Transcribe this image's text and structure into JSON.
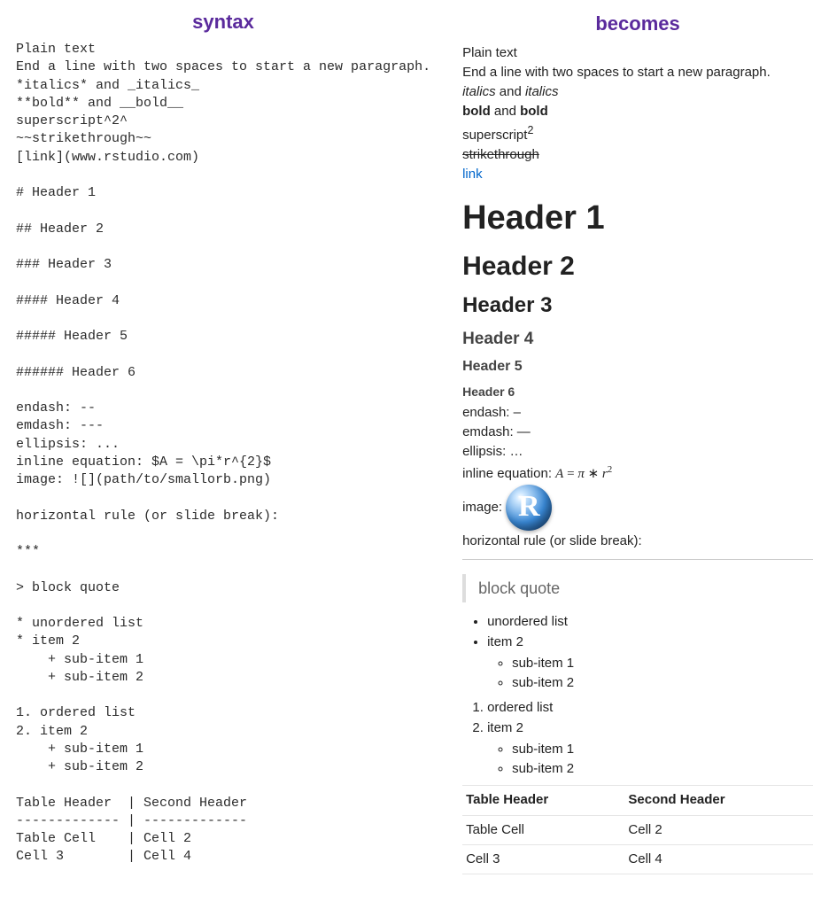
{
  "titles": {
    "left": "syntax",
    "right": "becomes"
  },
  "syntax_block": "Plain text\nEnd a line with two spaces to start a new paragraph.\n*italics* and _italics_\n**bold** and __bold__\nsuperscript^2^\n~~strikethrough~~\n[link](www.rstudio.com)\n\n# Header 1\n\n## Header 2\n\n### Header 3\n\n#### Header 4\n\n##### Header 5\n\n###### Header 6\n\nendash: --\nemdash: ---\nellipsis: ...\ninline equation: $A = \\pi*r^{2}$\nimage: ![](path/to/smallorb.png)\n\nhorizontal rule (or slide break):\n\n***\n\n> block quote\n\n* unordered list\n* item 2\n    + sub-item 1\n    + sub-item 2\n\n1. ordered list\n2. item 2\n    + sub-item 1\n    + sub-item 2\n\nTable Header  | Second Header\n------------- | -------------\nTable Cell    | Cell 2\nCell 3        | Cell 4",
  "rendered": {
    "plain1": "Plain text",
    "plain2": "End a line with two spaces to start a new paragraph.",
    "italics_word": "italics",
    "and": " and ",
    "bold_word": "bold",
    "superscript_label": "superscript",
    "superscript_exp": "2",
    "strikethrough": "strikethrough",
    "link_text": "link",
    "h1": "Header 1",
    "h2": "Header 2",
    "h3": "Header 3",
    "h4": "Header 4",
    "h5": "Header 5",
    "h6": "Header 6",
    "endash_label": "endash: ",
    "endash": "–",
    "emdash_label": "emdash: ",
    "emdash": "—",
    "ellipsis_label": "ellipsis: ",
    "ellipsis": "…",
    "eq_label": "inline equation: ",
    "eq_A": "A",
    "eq_eq": " = ",
    "eq_pi": "π",
    "eq_star": " ∗ ",
    "eq_r": "r",
    "eq_exp": "2",
    "image_label": "image: ",
    "rlogo_letter": "R",
    "hr_label": "horizontal rule (or slide break):",
    "blockquote": "block quote",
    "ul_item1": "unordered list",
    "ul_item2": "item 2",
    "ul_sub1": "sub-item 1",
    "ul_sub2": "sub-item 2",
    "ol_item1": "ordered list",
    "ol_item2": "item 2",
    "ol_sub1": "sub-item 1",
    "ol_sub2": "sub-item 2",
    "table": {
      "th1": "Table Header",
      "th2": "Second Header",
      "r1c1": "Table Cell",
      "r1c2": "Cell 2",
      "r2c1": "Cell 3",
      "r2c2": "Cell 4"
    }
  }
}
